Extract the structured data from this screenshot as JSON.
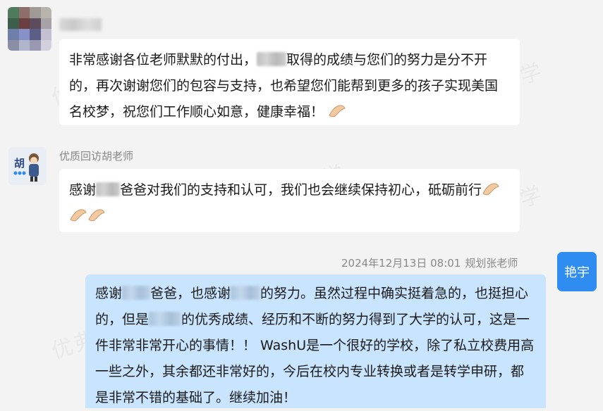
{
  "watermark": "优弗留学",
  "messages": [
    {
      "sender": "",
      "text_parts": [
        "非常感谢各位老师默默的付出，",
        "取得的成绩与您们的努力是分不开的，再次谢谢您们的包容与支持，也希望您们能帮到更多的孩子实现美国名校梦，祝您们工作顺心如意，健康幸福！"
      ]
    },
    {
      "sender": "优质回访胡老师",
      "text_parts": [
        "感谢",
        "爸爸对我们的支持和认可，我们也会继续保持初心，砥砺前行"
      ]
    },
    {
      "sender": "规划张老师",
      "timestamp": "2024年12月13日 08:01",
      "avatar_text": "艳宇",
      "text_parts": [
        "感谢",
        "爸爸，也感谢",
        "的努力。虽然过程中确实挺着急的，也挺担心的，但是",
        "的优秀成绩、经历和不断的努力得到了大学的认可，这是一件非常非常开心的事情！！ WashU是一个很好的学校，除了私立校费用高一些之外，其余都还非常好的，今后在校内专业转换或者是转学申研，都是非常不错的基础了。继续加油！"
      ]
    }
  ],
  "colors": {
    "background": "#f3f3f3",
    "bubble_white": "#ffffff",
    "bubble_blue": "#c9e4ff",
    "avatar_blue": "#2f8cf0"
  }
}
